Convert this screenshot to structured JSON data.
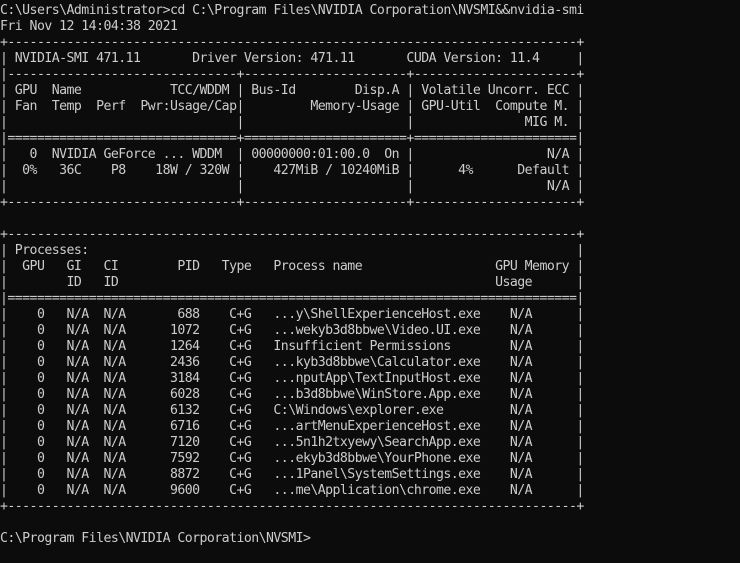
{
  "console": {
    "command": "C:\\Users\\Administrator>cd C:\\Program Files\\NVIDIA Corporation\\NVSMI&&nvidia-smi",
    "timestamp": "Fri Nov 12 14:04:38 2021",
    "prompt": "C:\\Program Files\\NVIDIA Corporation\\NVSMI>"
  },
  "smi_table": [
    "+-----------------------------------------------------------------------------+",
    "| NVIDIA-SMI 471.11       Driver Version: 471.11       CUDA Version: 11.4     |",
    "|-------------------------------+----------------------+----------------------+",
    "| GPU  Name            TCC/WDDM | Bus-Id        Disp.A | Volatile Uncorr. ECC |",
    "| Fan  Temp  Perf  Pwr:Usage/Cap|         Memory-Usage | GPU-Util  Compute M. |",
    "|                               |                      |               MIG M. |",
    "|===============================+======================+======================|",
    "|   0  NVIDIA GeForce ... WDDM  | 00000000:01:00.0  On |                  N/A |",
    "|  0%   36C    P8    18W / 320W |    427MiB / 10240MiB |      4%      Default |",
    "|                               |                      |                  N/A |",
    "+-------------------------------+----------------------+----------------------+",
    "",
    "+-----------------------------------------------------------------------------+",
    "| Processes:                                                                  |",
    "|  GPU   GI   CI        PID   Type   Process name                  GPU Memory |",
    "|        ID   ID                                                   Usage      |",
    "|=============================================================================|",
    "|    0   N/A  N/A       688    C+G   ...y\\ShellExperienceHost.exe    N/A      |",
    "|    0   N/A  N/A      1072    C+G   ...wekyb3d8bbwe\\Video.UI.exe    N/A      |",
    "|    0   N/A  N/A      1264    C+G   Insufficient Permissions        N/A      |",
    "|    0   N/A  N/A      2436    C+G   ...kyb3d8bbwe\\Calculator.exe    N/A      |",
    "|    0   N/A  N/A      3184    C+G   ...nputApp\\TextInputHost.exe    N/A      |",
    "|    0   N/A  N/A      6028    C+G   ...b3d8bbwe\\WinStore.App.exe    N/A      |",
    "|    0   N/A  N/A      6132    C+G   C:\\Windows\\explorer.exe         N/A      |",
    "|    0   N/A  N/A      6716    C+G   ...artMenuExperienceHost.exe    N/A      |",
    "|    0   N/A  N/A      7120    C+G   ...5n1h2txyewy\\SearchApp.exe    N/A      |",
    "|    0   N/A  N/A      7592    C+G   ...ekyb3d8bbwe\\YourPhone.exe    N/A      |",
    "|    0   N/A  N/A      8872    C+G   ...1Panel\\SystemSettings.exe    N/A      |",
    "|    0   N/A  N/A      9600    C+G   ...me\\Application\\chrome.exe    N/A      |",
    "+-----------------------------------------------------------------------------+"
  ],
  "colors": {
    "background": "#0c0c0c",
    "foreground": "#cccccc"
  }
}
